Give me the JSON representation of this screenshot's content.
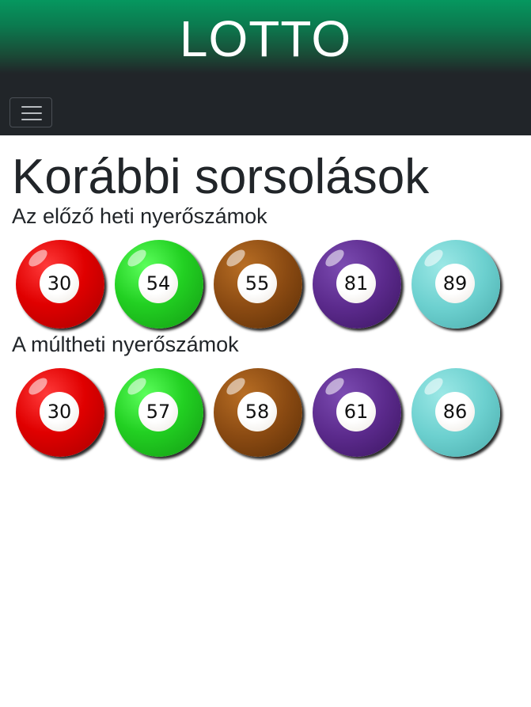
{
  "header": {
    "title": "LOTTO"
  },
  "navbar": {
    "toggler_icon": "hamburger-menu-icon"
  },
  "main": {
    "page_title": "Korábbi sorsolások",
    "sections": [
      {
        "title": "Az előző heti nyerőszámok",
        "balls": [
          {
            "number": "30",
            "color": "#d00000"
          },
          {
            "number": "54",
            "color": "#22d022"
          },
          {
            "number": "55",
            "color": "#8a4a12"
          },
          {
            "number": "81",
            "color": "#5b2a8c"
          },
          {
            "number": "89",
            "color": "#6cd0cf"
          }
        ]
      },
      {
        "title": "A múltheti nyerőszámok",
        "balls": [
          {
            "number": "30",
            "color": "#d00000"
          },
          {
            "number": "57",
            "color": "#22d022"
          },
          {
            "number": "58",
            "color": "#8a4a12"
          },
          {
            "number": "61",
            "color": "#5b2a8c"
          },
          {
            "number": "86",
            "color": "#6cd0cf"
          }
        ]
      }
    ]
  }
}
